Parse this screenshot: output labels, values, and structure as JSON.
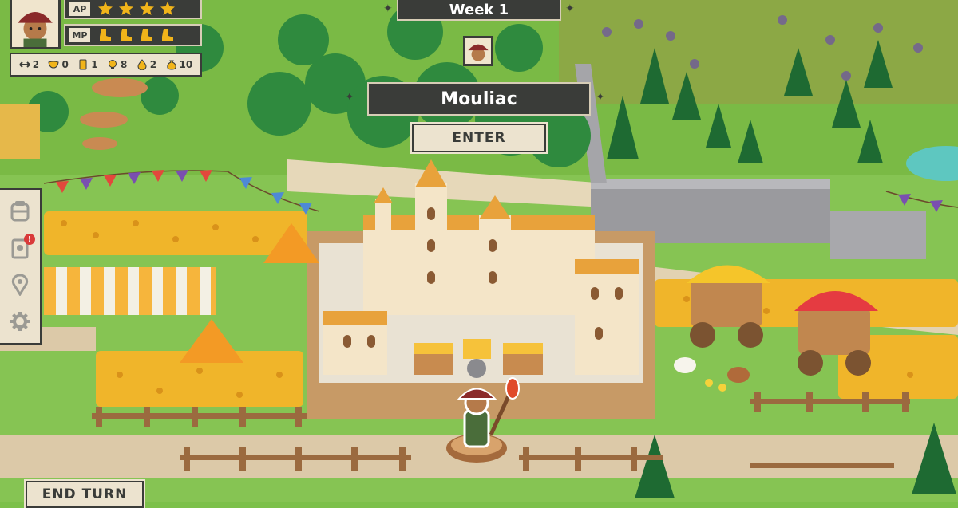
{
  "hud": {
    "ap_label": "AP",
    "mp_label": "MP",
    "ap_stars": 4,
    "mp_boots": 4,
    "resources": [
      {
        "icon": "arrows-icon",
        "value": "2"
      },
      {
        "icon": "mask-icon",
        "value": "0"
      },
      {
        "icon": "scroll-icon",
        "value": "1"
      },
      {
        "icon": "bulb-icon",
        "value": "8"
      },
      {
        "icon": "drop-icon",
        "value": "2"
      },
      {
        "icon": "moneybag-icon",
        "value": "10"
      }
    ]
  },
  "top_banner": {
    "week": "Week 1"
  },
  "location": {
    "name": "Mouliac",
    "enter_label": "ENTER"
  },
  "sidebar": {
    "items": [
      {
        "icon": "inventory-icon"
      },
      {
        "icon": "quest-scroll-icon",
        "alert": "!"
      },
      {
        "icon": "map-pin-icon"
      },
      {
        "icon": "gear-icon"
      }
    ]
  },
  "end_turn_label": "END TURN",
  "colors": {
    "panel_dark": "#3a3c39",
    "panel_light": "#ece3cf",
    "star": "#f1b41a",
    "alert": "#d93a3a"
  }
}
